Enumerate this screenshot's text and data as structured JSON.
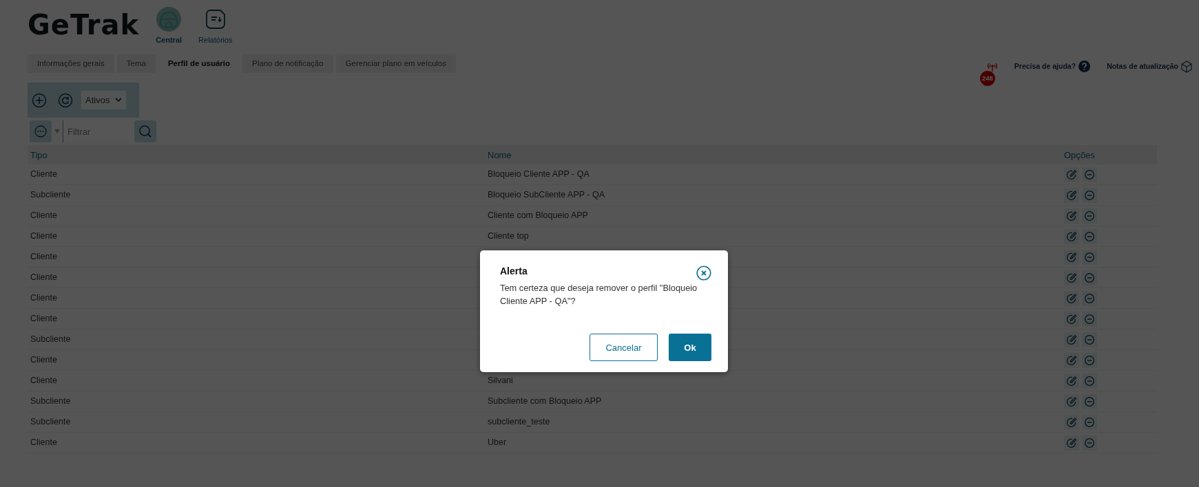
{
  "header": {
    "logo": "GeTrak",
    "nav": [
      {
        "label": "Central",
        "selected": true
      },
      {
        "label": "Relatórios",
        "selected": false
      }
    ],
    "notification_count": "248",
    "help": "Precisa de ajuda?",
    "updates": "Notas de atualização"
  },
  "tabs": [
    {
      "label": "Informações gerais",
      "selected": false
    },
    {
      "label": "Tema",
      "selected": false
    },
    {
      "label": "Perfil de usuário",
      "selected": true
    },
    {
      "label": "Plano de notificação",
      "selected": false
    },
    {
      "label": "Gerenciar plano em veículos",
      "selected": false
    }
  ],
  "toolbar": {
    "status_select": "Ativos",
    "filter": {
      "placeholder": "Filtrar"
    }
  },
  "table": {
    "columns": [
      "Tipo",
      "Nome",
      "Opções"
    ],
    "rows": [
      {
        "tipo": "Cliente",
        "nome": "Bloqueio Cliente APP - QA"
      },
      {
        "tipo": "Subcliente",
        "nome": "Bloqueio SubCliente APP - QA"
      },
      {
        "tipo": "Cliente",
        "nome": "Cliente com Bloqueio APP"
      },
      {
        "tipo": "Cliente",
        "nome": "Cliente top"
      },
      {
        "tipo": "Cliente"
      },
      {
        "tipo": "Cliente"
      },
      {
        "tipo": "Cliente"
      },
      {
        "tipo": "Cliente"
      },
      {
        "tipo": "Subcliente"
      },
      {
        "tipo": "Cliente"
      },
      {
        "tipo": "Cliente",
        "nome": "Silvani"
      },
      {
        "tipo": "Subcliente",
        "nome": "Subcliente com Bloqueio APP"
      },
      {
        "tipo": "Subcliente",
        "nome": "subcliente_teste"
      },
      {
        "tipo": "Cliente",
        "nome": "Uber"
      }
    ]
  },
  "dialog": {
    "title": "Alerta",
    "message": "Tem certeza que deseja remover o perfil \"Bloqueio Cliente APP - QA\"?",
    "buttons": [
      {
        "label": "Cancelar",
        "kind": "secondary"
      },
      {
        "label": "Ok",
        "kind": "primary"
      }
    ]
  }
}
